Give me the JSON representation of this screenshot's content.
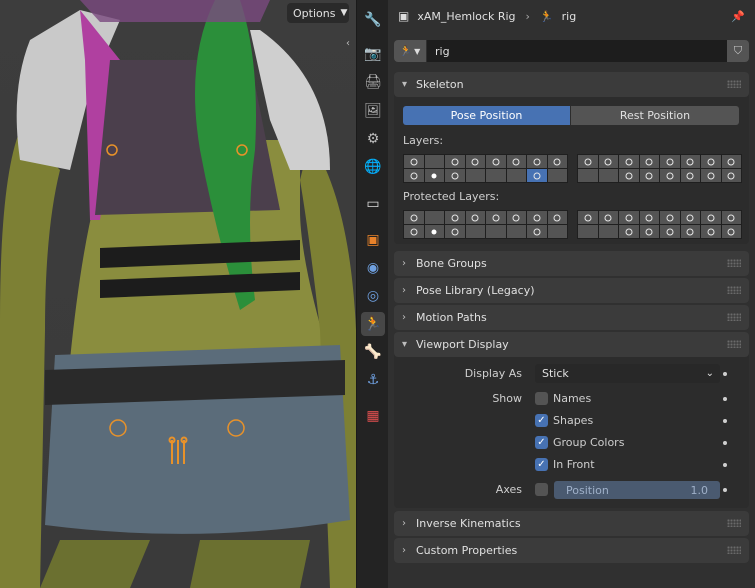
{
  "viewport": {
    "options_label": "Options"
  },
  "header": {
    "object_name": "xAM_Hemlock Rig",
    "data_name": "rig"
  },
  "datablock": {
    "name": "rig"
  },
  "skeleton": {
    "title": "Skeleton",
    "pose_position": "Pose Position",
    "rest_position": "Rest Position",
    "layers_label": "Layers:",
    "protected_label": "Protected Layers:"
  },
  "panels": {
    "bone_groups": "Bone Groups",
    "pose_library": "Pose Library (Legacy)",
    "motion_paths": "Motion Paths",
    "viewport_display": "Viewport Display",
    "inverse_kinematics": "Inverse Kinematics",
    "custom_properties": "Custom Properties"
  },
  "viewport_display": {
    "display_as_label": "Display As",
    "display_as_value": "Stick",
    "show_label": "Show",
    "names": "Names",
    "shapes": "Shapes",
    "group_colors": "Group Colors",
    "in_front": "In Front",
    "axes_label": "Axes",
    "position_label": "Position",
    "position_value": "1.0"
  }
}
